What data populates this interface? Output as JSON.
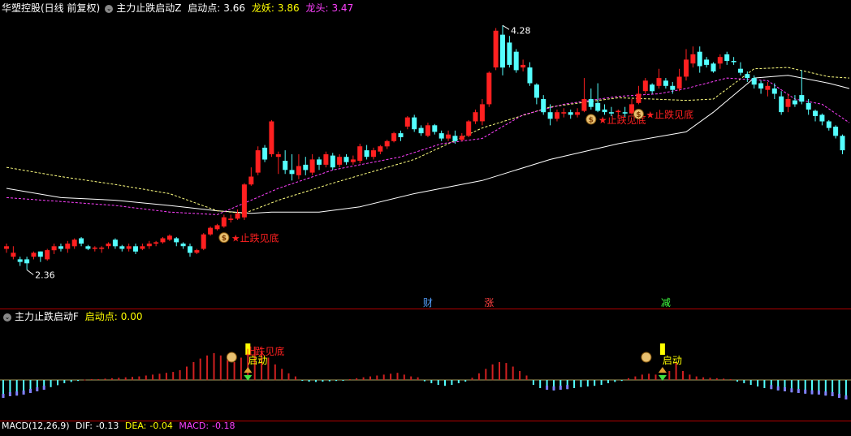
{
  "header_main": {
    "stock": "华塑控股(日线 前复权)",
    "indicator": "主力止跌启动Z",
    "qidong_label": "启动点:",
    "qidong_value": "3.66",
    "longyao_label": "龙妖:",
    "longyao_value": "3.86",
    "longtou_label": "龙头:",
    "longtou_value": "3.47"
  },
  "header_sub": {
    "indicator": "主力止跌启动F",
    "qidong_label": "启动点:",
    "qidong_value": "0.00"
  },
  "header_macd": {
    "text": "MACD(12,26,9)",
    "dif_label": "DIF:",
    "dif_value": "-0.13",
    "dea_label": "DEA:",
    "dea_value": "-0.04",
    "macd_label": "MACD:",
    "macd_value": "-0.18"
  },
  "colors": {
    "up": "#ff2020",
    "down": "#54ffff",
    "ma_white": "#ffffff",
    "ma_yellow": "#ffff80",
    "ma_magenta": "#ff40ff",
    "header_yellow": "#ffff00",
    "header_magenta": "#ff40ff",
    "marker_red": "#ff2020",
    "cai_color": "#54a0ff",
    "zhang_color": "#ff4040",
    "jian_color": "#40ff40"
  },
  "chart_data": [
    {
      "type": "candlestick",
      "ylim": [
        2.2,
        4.35
      ],
      "annotations": {
        "high_label": "4.28",
        "low_label": "2.36",
        "signal_label": "★止跌见底",
        "cai": "财",
        "zhang": "涨",
        "jian": "减"
      },
      "signal_indices": [
        32,
        86,
        93
      ],
      "news_markers": [
        {
          "index": 62,
          "key": "cai"
        },
        {
          "index": 71,
          "key": "zhang"
        },
        {
          "index": 97,
          "key": "jian"
        }
      ],
      "candles": [
        [
          2.58,
          2.6,
          2.55,
          2.62
        ],
        [
          2.52,
          2.55,
          2.5,
          2.6
        ],
        [
          2.5,
          2.48,
          2.45,
          2.52
        ],
        [
          2.5,
          2.47,
          2.42,
          2.52
        ],
        [
          2.52,
          2.55,
          2.5,
          2.56
        ],
        [
          2.56,
          2.52,
          2.48,
          2.56
        ],
        [
          2.5,
          2.57,
          2.49,
          2.58
        ],
        [
          2.57,
          2.6,
          2.54,
          2.62
        ],
        [
          2.6,
          2.58,
          2.56,
          2.62
        ],
        [
          2.58,
          2.62,
          2.55,
          2.64
        ],
        [
          2.6,
          2.65,
          2.58,
          2.66
        ],
        [
          2.66,
          2.62,
          2.6,
          2.67
        ],
        [
          2.6,
          2.58,
          2.57,
          2.61
        ],
        [
          2.58,
          2.59,
          2.56,
          2.6
        ],
        [
          2.58,
          2.59,
          2.55,
          2.6
        ],
        [
          2.6,
          2.62,
          2.58,
          2.63
        ],
        [
          2.65,
          2.6,
          2.58,
          2.66
        ],
        [
          2.6,
          2.58,
          2.56,
          2.61
        ],
        [
          2.58,
          2.6,
          2.56,
          2.62
        ],
        [
          2.6,
          2.56,
          2.54,
          2.62
        ],
        [
          2.58,
          2.6,
          2.57,
          2.62
        ],
        [
          2.6,
          2.62,
          2.58,
          2.64
        ],
        [
          2.62,
          2.63,
          2.6,
          2.64
        ],
        [
          2.63,
          2.66,
          2.62,
          2.67
        ],
        [
          2.65,
          2.68,
          2.64,
          2.69
        ],
        [
          2.66,
          2.63,
          2.6,
          2.67
        ],
        [
          2.62,
          2.6,
          2.58,
          2.63
        ],
        [
          2.6,
          2.55,
          2.52,
          2.62
        ],
        [
          2.55,
          2.57,
          2.54,
          2.58
        ],
        [
          2.58,
          2.69,
          2.57,
          2.7
        ],
        [
          2.69,
          2.74,
          2.68,
          2.75
        ],
        [
          2.73,
          2.76,
          2.72,
          2.77
        ],
        [
          2.75,
          2.82,
          2.74,
          2.84
        ],
        [
          2.8,
          2.81,
          2.78,
          2.84
        ],
        [
          2.81,
          2.85,
          2.8,
          2.88
        ],
        [
          2.82,
          3.07,
          2.8,
          3.08
        ],
        [
          3.07,
          3.13,
          3.06,
          3.2
        ],
        [
          3.16,
          3.33,
          3.14,
          3.36
        ],
        [
          3.35,
          3.26,
          3.24,
          3.37
        ],
        [
          3.3,
          3.55,
          3.28,
          3.56
        ],
        [
          3.28,
          3.3,
          3.15,
          3.32
        ],
        [
          3.25,
          3.18,
          3.15,
          3.33
        ],
        [
          3.18,
          3.15,
          3.1,
          3.3
        ],
        [
          3.14,
          3.21,
          3.11,
          3.3
        ],
        [
          3.22,
          3.18,
          3.14,
          3.28
        ],
        [
          3.16,
          3.26,
          3.14,
          3.3
        ],
        [
          3.26,
          3.22,
          3.18,
          3.28
        ],
        [
          3.22,
          3.3,
          3.2,
          3.32
        ],
        [
          3.29,
          3.2,
          3.18,
          3.31
        ],
        [
          3.22,
          3.28,
          3.2,
          3.3
        ],
        [
          3.28,
          3.24,
          3.22,
          3.3
        ],
        [
          3.24,
          3.26,
          3.22,
          3.29
        ],
        [
          3.25,
          3.36,
          3.23,
          3.38
        ],
        [
          3.33,
          3.28,
          3.26,
          3.37
        ],
        [
          3.28,
          3.33,
          3.26,
          3.35
        ],
        [
          3.32,
          3.36,
          3.3,
          3.37
        ],
        [
          3.36,
          3.4,
          3.34,
          3.41
        ],
        [
          3.4,
          3.46,
          3.39,
          3.47
        ],
        [
          3.46,
          3.43,
          3.4,
          3.48
        ],
        [
          3.51,
          3.58,
          3.49,
          3.59
        ],
        [
          3.58,
          3.49,
          3.47,
          3.6
        ],
        [
          3.5,
          3.46,
          3.44,
          3.52
        ],
        [
          3.44,
          3.52,
          3.43,
          3.54
        ],
        [
          3.52,
          3.47,
          3.45,
          3.53
        ],
        [
          3.46,
          3.42,
          3.4,
          3.48
        ],
        [
          3.42,
          3.45,
          3.4,
          3.48
        ],
        [
          3.44,
          3.4,
          3.38,
          3.48
        ],
        [
          3.41,
          3.44,
          3.4,
          3.46
        ],
        [
          3.44,
          3.55,
          3.43,
          3.56
        ],
        [
          3.55,
          3.62,
          3.53,
          3.64
        ],
        [
          3.55,
          3.68,
          3.52,
          3.72
        ],
        [
          3.68,
          3.92,
          3.66,
          3.93
        ],
        [
          3.96,
          4.24,
          3.94,
          4.26
        ],
        [
          4.21,
          3.96,
          3.9,
          4.28
        ],
        [
          4.15,
          3.98,
          3.96,
          4.2
        ],
        [
          4.08,
          3.94,
          3.92,
          4.1
        ],
        [
          3.96,
          3.98,
          3.93,
          4.02
        ],
        [
          3.96,
          3.84,
          3.82,
          4.0
        ],
        [
          3.83,
          3.73,
          3.68,
          3.84
        ],
        [
          3.72,
          3.62,
          3.6,
          3.75
        ],
        [
          3.62,
          3.57,
          3.52,
          3.68
        ],
        [
          3.57,
          3.62,
          3.55,
          3.64
        ],
        [
          3.61,
          3.62,
          3.58,
          3.65
        ],
        [
          3.62,
          3.6,
          3.57,
          3.64
        ],
        [
          3.6,
          3.62,
          3.58,
          3.65
        ],
        [
          3.63,
          3.72,
          3.62,
          3.88
        ],
        [
          3.72,
          3.66,
          3.64,
          3.8
        ],
        [
          3.69,
          3.63,
          3.62,
          3.84
        ],
        [
          3.64,
          3.62,
          3.6,
          3.68
        ],
        [
          3.62,
          3.61,
          3.59,
          3.66
        ],
        [
          3.62,
          3.63,
          3.58,
          3.64
        ],
        [
          3.62,
          3.61,
          3.58,
          3.66
        ],
        [
          3.61,
          3.68,
          3.6,
          3.72
        ],
        [
          3.69,
          3.76,
          3.68,
          3.82
        ],
        [
          3.78,
          3.86,
          3.76,
          3.88
        ],
        [
          3.83,
          3.78,
          3.76,
          3.84
        ],
        [
          3.82,
          3.88,
          3.8,
          3.95
        ],
        [
          3.86,
          3.82,
          3.8,
          3.88
        ],
        [
          3.82,
          3.79,
          3.76,
          3.85
        ],
        [
          3.8,
          3.89,
          3.78,
          3.95
        ],
        [
          3.89,
          4.02,
          3.86,
          4.1
        ],
        [
          3.99,
          4.06,
          3.96,
          4.12
        ],
        [
          4.08,
          3.97,
          3.92,
          4.12
        ],
        [
          4.02,
          3.98,
          3.96,
          4.04
        ],
        [
          3.99,
          3.93,
          3.92,
          4.0
        ],
        [
          3.99,
          4.04,
          3.95,
          4.06
        ],
        [
          4.06,
          4.01,
          3.98,
          4.08
        ],
        [
          4.01,
          4.0,
          3.98,
          4.04
        ],
        [
          3.95,
          3.92,
          3.9,
          4.0
        ],
        [
          3.91,
          3.88,
          3.85,
          3.93
        ],
        [
          3.88,
          3.83,
          3.8,
          3.9
        ],
        [
          3.84,
          3.8,
          3.76,
          3.86
        ],
        [
          3.79,
          3.82,
          3.74,
          3.85
        ],
        [
          3.8,
          3.76,
          3.72,
          3.84
        ],
        [
          3.74,
          3.62,
          3.6,
          3.78
        ],
        [
          3.66,
          3.72,
          3.62,
          3.76
        ],
        [
          3.71,
          3.68,
          3.66,
          3.75
        ],
        [
          3.75,
          3.7,
          3.68,
          3.94
        ],
        [
          3.69,
          3.64,
          3.6,
          3.72
        ],
        [
          3.63,
          3.59,
          3.55,
          3.64
        ],
        [
          3.6,
          3.55,
          3.52,
          3.61
        ],
        [
          3.55,
          3.5,
          3.48,
          3.56
        ],
        [
          3.51,
          3.44,
          3.42,
          3.52
        ],
        [
          3.44,
          3.33,
          3.3,
          3.45
        ]
      ],
      "ma_white": [
        [
          0,
          3.04
        ],
        [
          8,
          2.97
        ],
        [
          16,
          2.95
        ],
        [
          24,
          2.91
        ],
        [
          31,
          2.87
        ],
        [
          36,
          2.85
        ],
        [
          39,
          2.86
        ],
        [
          46,
          2.86
        ],
        [
          52,
          2.9
        ],
        [
          60,
          3.0
        ],
        [
          70,
          3.1
        ],
        [
          80,
          3.26
        ],
        [
          90,
          3.38
        ],
        [
          100,
          3.47
        ],
        [
          104,
          3.62
        ],
        [
          110,
          3.88
        ],
        [
          115,
          3.9
        ],
        [
          121,
          3.84
        ],
        [
          124,
          3.8
        ]
      ],
      "ma_yellow": [
        [
          0,
          3.2
        ],
        [
          8,
          3.13
        ],
        [
          16,
          3.07
        ],
        [
          24,
          3.0
        ],
        [
          31,
          2.87
        ],
        [
          35,
          2.85
        ],
        [
          40,
          2.95
        ],
        [
          48,
          3.08
        ],
        [
          60,
          3.26
        ],
        [
          70,
          3.5
        ],
        [
          80,
          3.66
        ],
        [
          90,
          3.73
        ],
        [
          100,
          3.71
        ],
        [
          104,
          3.72
        ],
        [
          110,
          3.95
        ],
        [
          115,
          3.96
        ],
        [
          121,
          3.89
        ],
        [
          124,
          3.88
        ]
      ],
      "ma_magenta": [
        [
          0,
          2.97
        ],
        [
          8,
          2.94
        ],
        [
          16,
          2.91
        ],
        [
          24,
          2.86
        ],
        [
          31,
          2.84
        ],
        [
          36,
          2.95
        ],
        [
          40,
          3.04
        ],
        [
          48,
          3.18
        ],
        [
          58,
          3.28
        ],
        [
          64,
          3.38
        ],
        [
          70,
          3.42
        ],
        [
          76,
          3.6
        ],
        [
          82,
          3.68
        ],
        [
          90,
          3.74
        ],
        [
          96,
          3.76
        ],
        [
          100,
          3.8
        ],
        [
          106,
          3.88
        ],
        [
          112,
          3.86
        ],
        [
          116,
          3.72
        ],
        [
          120,
          3.68
        ],
        [
          124,
          3.54
        ]
      ]
    },
    {
      "type": "bar",
      "ylim": [
        -1.0,
        1.0
      ],
      "annotations": {
        "signal_label": "止跌见底",
        "start_label": "启动"
      },
      "signal_indices": [
        36,
        97
      ],
      "values": [
        -0.55,
        -0.5,
        -0.48,
        -0.45,
        -0.4,
        -0.35,
        -0.3,
        -0.22,
        -0.16,
        -0.1,
        -0.06,
        -0.03,
        0.01,
        0.02,
        0.02,
        0.03,
        0.04,
        0.05,
        0.06,
        0.07,
        0.08,
        0.1,
        0.12,
        0.14,
        0.16,
        0.18,
        0.22,
        0.3,
        0.4,
        0.48,
        0.55,
        0.6,
        0.55,
        0.45,
        0.4,
        0.5,
        0.65,
        0.75,
        0.65,
        0.5,
        0.35,
        0.25,
        0.15,
        0.08,
        -0.02,
        -0.05,
        -0.06,
        -0.05,
        -0.04,
        -0.03,
        -0.02,
        0.02,
        0.04,
        0.06,
        0.08,
        0.1,
        0.12,
        0.14,
        0.16,
        0.12,
        0.08,
        0.06,
        -0.04,
        -0.1,
        -0.15,
        -0.18,
        -0.15,
        -0.1,
        -0.05,
        0.05,
        0.15,
        0.25,
        0.35,
        0.4,
        0.38,
        0.3,
        0.2,
        0.1,
        -0.15,
        -0.25,
        -0.3,
        -0.32,
        -0.3,
        -0.28,
        -0.25,
        -0.22,
        -0.2,
        -0.18,
        -0.15,
        -0.1,
        -0.06,
        -0.03,
        0.04,
        0.08,
        0.12,
        0.14,
        0.12,
        0.1,
        0.2,
        0.4,
        0.2,
        0.12,
        0.08,
        0.06,
        0.05,
        0.04,
        0.03,
        0.02,
        -0.05,
        -0.1,
        -0.15,
        -0.2,
        -0.25,
        -0.28,
        -0.32,
        -0.35,
        -0.38,
        -0.4,
        -0.42,
        -0.44,
        -0.45,
        -0.48,
        -0.5,
        -0.55,
        -0.6
      ]
    }
  ]
}
